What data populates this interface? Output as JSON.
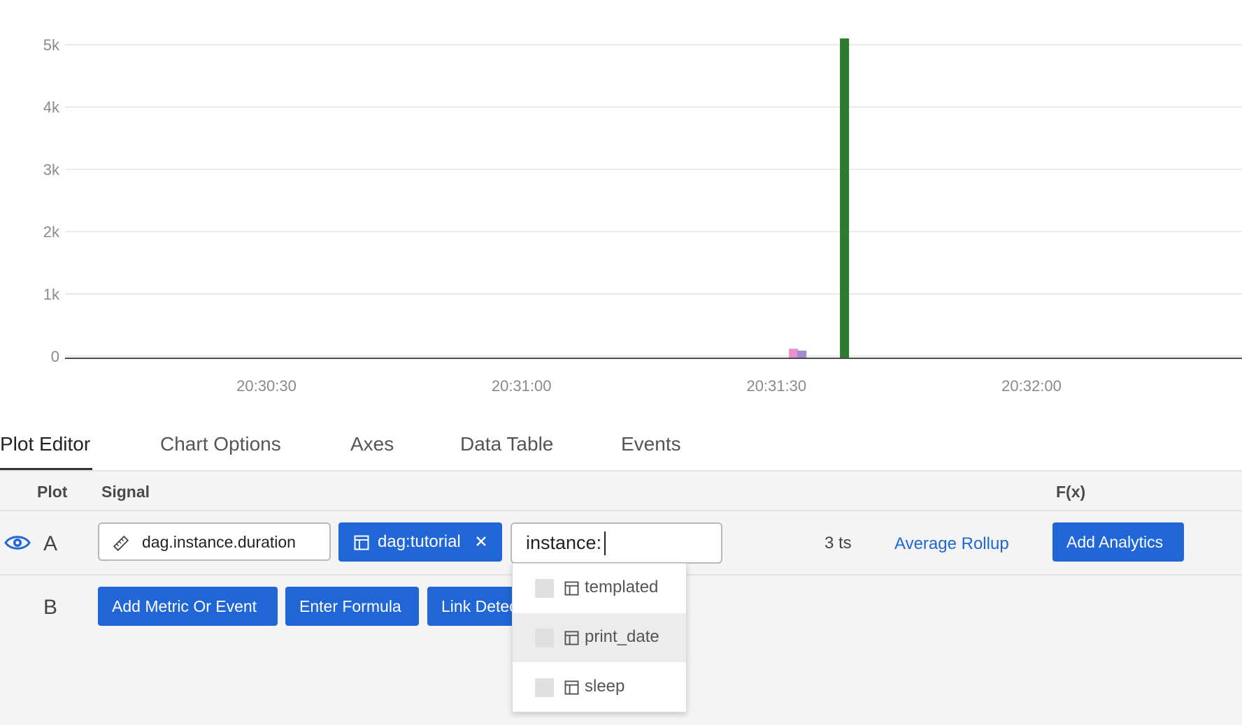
{
  "chart_data": {
    "type": "bar",
    "x_ticks": [
      "20:30:30",
      "20:31:00",
      "20:31:30",
      "20:32:00"
    ],
    "y_ticks": [
      "0",
      "1k",
      "2k",
      "3k",
      "4k",
      "5k"
    ],
    "ylim": [
      0,
      5100
    ],
    "grid": true,
    "series": [
      {
        "color": "#e88fcf",
        "points": [
          {
            "x": "20:31:32",
            "y": 120
          }
        ]
      },
      {
        "color": "#9f8fcf",
        "points": [
          {
            "x": "20:31:33",
            "y": 90
          }
        ]
      },
      {
        "color": "#2e7a2e",
        "points": [
          {
            "x": "20:31:38",
            "y": 5100
          }
        ]
      }
    ]
  },
  "tabs": [
    {
      "label": "Plot Editor",
      "active": true
    },
    {
      "label": "Chart Options",
      "active": false
    },
    {
      "label": "Axes",
      "active": false
    },
    {
      "label": "Data Table",
      "active": false
    },
    {
      "label": "Events",
      "active": false
    }
  ],
  "editor": {
    "headers": {
      "plot": "Plot",
      "signal": "Signal",
      "fx": "F(x)"
    },
    "row_a": {
      "letter": "A",
      "metric": "dag.instance.duration",
      "filter": "dag:tutorial",
      "filter_input": "instance:",
      "ts_count": "3 ts",
      "rollup": "Average Rollup",
      "analytics_button": "Add Analytics"
    },
    "row_b": {
      "letter": "B",
      "add_metric_button": "Add Metric Or Event",
      "formula_button": "Enter Formula",
      "detector_button": "Link Detector"
    },
    "dropdown": {
      "items": [
        "templated",
        "print_date",
        "sleep"
      ],
      "highlighted_index": 1
    }
  },
  "colors": {
    "accent": "#2166d6",
    "grid": "#e2e2e2",
    "axis": "#4a4a4a"
  },
  "icons": [
    "ruler-icon",
    "dimension-icon",
    "close-icon",
    "eye-icon"
  ]
}
